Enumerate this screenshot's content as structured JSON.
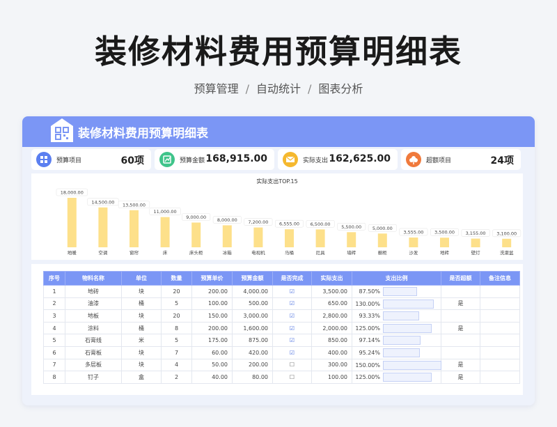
{
  "hero": {
    "title": "装修材料费用预算明细表",
    "sub1": "预算管理",
    "sub2": "自动统计",
    "sub3": "图表分析",
    "sep": "/"
  },
  "header": {
    "title": "装修材料费用预算明细表"
  },
  "kpis": [
    {
      "label": "预算项目",
      "value": "60项",
      "color": "#5b7ff0",
      "icon": "grid-icon"
    },
    {
      "label": "预算金额",
      "value": "168,915.00",
      "color": "#3fc48a",
      "icon": "chart-icon"
    },
    {
      "label": "实际支出",
      "value": "162,625.00",
      "color": "#f5b82e",
      "icon": "mail-icon"
    },
    {
      "label": "超额项目",
      "value": "24项",
      "color": "#f07a3c",
      "icon": "flower-icon"
    }
  ],
  "chart_data": {
    "type": "bar",
    "title": "实际支出TOP.15",
    "categories": [
      "地暖",
      "空调",
      "窗帘",
      "床",
      "床头柜",
      "冰箱",
      "电视机",
      "马桶",
      "灶具",
      "墙砖",
      "橱柜",
      "沙发",
      "地砖",
      "壁灯",
      "洗漱盆"
    ],
    "values": [
      18000,
      14500,
      13500,
      11000,
      9000,
      8000,
      7200,
      6555,
      6500,
      5500,
      5000,
      3555,
      3500,
      3155,
      3100
    ],
    "labels": [
      "18,000.00",
      "14,500.00",
      "13,500.00",
      "11,000.00",
      "9,000.00",
      "8,000.00",
      "7,200.00",
      "6,555.00",
      "6,500.00",
      "5,500.00",
      "5,000.00",
      "3,555.00",
      "3,500.00",
      "3,155.00",
      "3,100.00"
    ],
    "ylim": [
      0,
      18000
    ],
    "bar_color": "#fde08a",
    "grid": false
  },
  "table": {
    "headers": [
      "序号",
      "物料名称",
      "单位",
      "数量",
      "预算单价",
      "预算金额",
      "是否完成",
      "实际支出",
      "支出比例",
      "是否超额",
      "备注信息"
    ],
    "rows": [
      {
        "no": "1",
        "name": "地砖",
        "unit": "块",
        "qty": "20",
        "price": "200.00",
        "budget": "4,000.00",
        "done": "☑",
        "actual": "3,500.00",
        "pct": "87.50%",
        "ratio": 0.875,
        "over": ""
      },
      {
        "no": "2",
        "name": "油漆",
        "unit": "桶",
        "qty": "5",
        "price": "100.00",
        "budget": "500.00",
        "done": "☑",
        "actual": "650.00",
        "pct": "130.00%",
        "ratio": 1.3,
        "over": "是"
      },
      {
        "no": "3",
        "name": "地板",
        "unit": "块",
        "qty": "20",
        "price": "150.00",
        "budget": "3,000.00",
        "done": "☑",
        "actual": "2,800.00",
        "pct": "93.33%",
        "ratio": 0.9333,
        "over": ""
      },
      {
        "no": "4",
        "name": "涂料",
        "unit": "桶",
        "qty": "8",
        "price": "200.00",
        "budget": "1,600.00",
        "done": "☑",
        "actual": "2,000.00",
        "pct": "125.00%",
        "ratio": 1.25,
        "over": "是"
      },
      {
        "no": "5",
        "name": "石膏线",
        "unit": "米",
        "qty": "5",
        "price": "175.00",
        "budget": "875.00",
        "done": "☑",
        "actual": "850.00",
        "pct": "97.14%",
        "ratio": 0.9714,
        "over": ""
      },
      {
        "no": "6",
        "name": "石膏板",
        "unit": "块",
        "qty": "7",
        "price": "60.00",
        "budget": "420.00",
        "done": "☑",
        "actual": "400.00",
        "pct": "95.24%",
        "ratio": 0.9524,
        "over": ""
      },
      {
        "no": "7",
        "name": "多层板",
        "unit": "块",
        "qty": "4",
        "price": "50.00",
        "budget": "200.00",
        "done": "☐",
        "actual": "300.00",
        "pct": "150.00%",
        "ratio": 1.5,
        "over": "是"
      },
      {
        "no": "8",
        "name": "钉子",
        "unit": "盒",
        "qty": "2",
        "price": "40.00",
        "budget": "80.00",
        "done": "☐",
        "actual": "100.00",
        "pct": "125.00%",
        "ratio": 1.25,
        "over": "是"
      }
    ]
  }
}
